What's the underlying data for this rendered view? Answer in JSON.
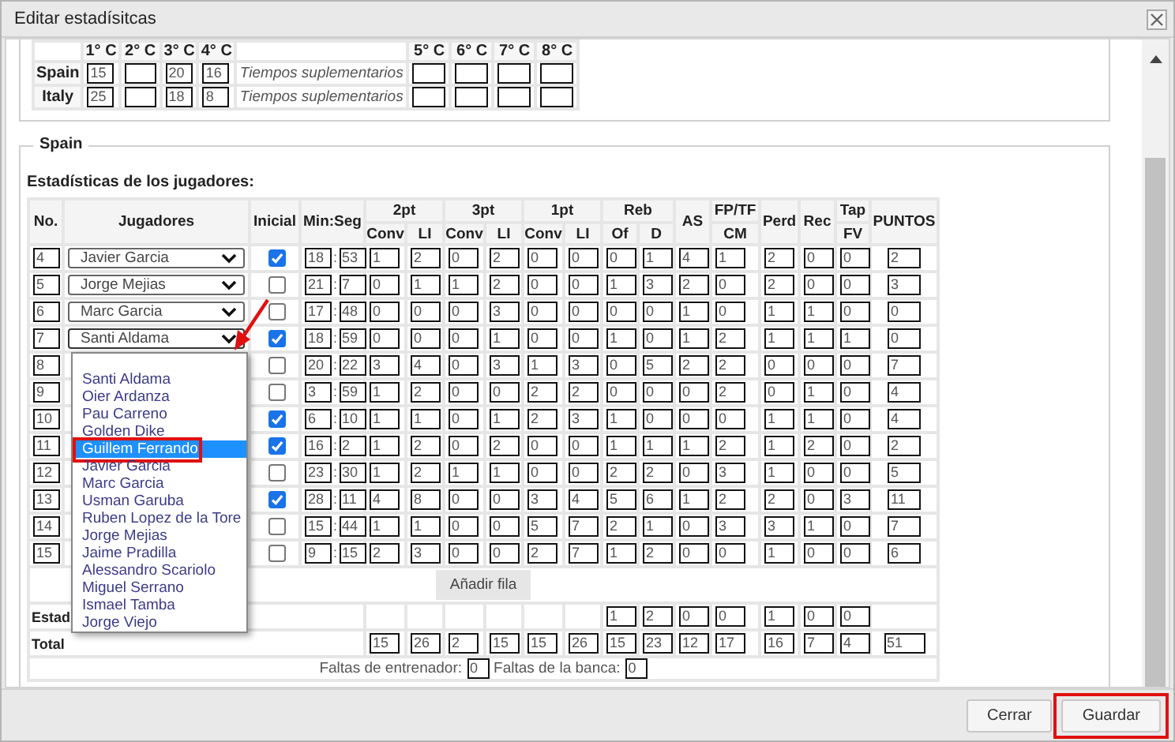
{
  "dialog": {
    "title": "Editar estadísitcas"
  },
  "quarters": {
    "columns": [
      "1° C",
      "2° C",
      "3° C",
      "4° C",
      "5° C",
      "6° C",
      "7° C",
      "8° C"
    ],
    "teams": [
      {
        "name": "Spain",
        "scores": [
          {
            "empty": false,
            "value": "15"
          },
          {
            "empty": true
          },
          {
            "empty": false,
            "value": "20"
          },
          {
            "empty": false,
            "value": "16"
          },
          {
            "empty": true
          },
          {
            "empty": true
          },
          {
            "empty": true
          },
          {
            "empty": true
          }
        ],
        "overtime_label": "Tiempos suplementarios"
      },
      {
        "name": "Italy",
        "scores": [
          {
            "empty": false,
            "value": "25"
          },
          {
            "empty": true
          },
          {
            "empty": false,
            "value": "18"
          },
          {
            "empty": false,
            "value": "8"
          },
          {
            "empty": true
          },
          {
            "empty": true
          },
          {
            "empty": true
          },
          {
            "empty": true
          }
        ],
        "overtime_label": "Tiempos suplementarios"
      }
    ]
  },
  "team_section": {
    "legend": "Spain",
    "heading": "Estadísticas de los jugadores:",
    "header_groups": [
      {
        "label": "No."
      },
      {
        "label": "Jugadores"
      },
      {
        "label": "Inicial"
      },
      {
        "label": "Min:Seg"
      },
      {
        "label": "2pt",
        "sub": [
          "Conv",
          "LI"
        ]
      },
      {
        "label": "3pt",
        "sub": [
          "Conv",
          "LI"
        ]
      },
      {
        "label": "1pt",
        "sub": [
          "Conv",
          "LI"
        ]
      },
      {
        "label": "Reb",
        "sub": [
          "Of",
          "D"
        ]
      },
      {
        "label": "AS"
      },
      {
        "label": "FP/TF",
        "sub": [
          "CM"
        ]
      },
      {
        "label": "Perd"
      },
      {
        "label": "Rec"
      },
      {
        "label": "Tap",
        "sub": [
          "FV"
        ]
      },
      {
        "label": "PUNTOS"
      }
    ],
    "time_separator": ":",
    "rows": [
      {
        "no": "4",
        "player": "Javier Garcia",
        "dropdown_open": false,
        "inicial": true,
        "min": "18",
        "sec": "53",
        "stats": [
          "1",
          "2",
          "0",
          "2",
          "0",
          "0",
          "0",
          "1",
          "4",
          "1",
          "2",
          "0",
          "0",
          "2"
        ]
      },
      {
        "no": "5",
        "player": "Jorge Mejias",
        "dropdown_open": false,
        "inicial": false,
        "min": "21",
        "sec": "7",
        "stats": [
          "0",
          "1",
          "1",
          "2",
          "0",
          "0",
          "1",
          "3",
          "2",
          "0",
          "2",
          "0",
          "0",
          "3"
        ]
      },
      {
        "no": "6",
        "player": "Marc Garcia",
        "dropdown_open": false,
        "inicial": false,
        "min": "17",
        "sec": "48",
        "stats": [
          "0",
          "0",
          "0",
          "3",
          "0",
          "0",
          "0",
          "0",
          "1",
          "0",
          "1",
          "1",
          "0",
          "0"
        ]
      },
      {
        "no": "7",
        "player": "Santi Aldama",
        "dropdown_open": true,
        "inicial": true,
        "min": "18",
        "sec": "59",
        "stats": [
          "0",
          "0",
          "0",
          "1",
          "0",
          "0",
          "1",
          "0",
          "1",
          "2",
          "1",
          "1",
          "1",
          "0"
        ]
      },
      {
        "no": "8",
        "inicial": false,
        "min": "20",
        "sec": "22",
        "stats": [
          "3",
          "4",
          "0",
          "3",
          "1",
          "3",
          "0",
          "5",
          "2",
          "2",
          "0",
          "0",
          "0",
          "7"
        ]
      },
      {
        "no": "9",
        "inicial": false,
        "min": "3",
        "sec": "59",
        "stats": [
          "1",
          "2",
          "0",
          "0",
          "2",
          "2",
          "0",
          "0",
          "0",
          "2",
          "0",
          "1",
          "0",
          "4"
        ]
      },
      {
        "no": "10",
        "inicial": true,
        "min": "6",
        "sec": "10",
        "stats": [
          "1",
          "1",
          "0",
          "1",
          "2",
          "3",
          "1",
          "0",
          "0",
          "0",
          "1",
          "1",
          "0",
          "4"
        ]
      },
      {
        "no": "11",
        "inicial": true,
        "min": "16",
        "sec": "2",
        "stats": [
          "1",
          "2",
          "0",
          "2",
          "0",
          "0",
          "1",
          "1",
          "1",
          "2",
          "1",
          "2",
          "0",
          "2"
        ]
      },
      {
        "no": "12",
        "inicial": false,
        "min": "23",
        "sec": "30",
        "stats": [
          "1",
          "2",
          "1",
          "1",
          "0",
          "0",
          "2",
          "2",
          "0",
          "3",
          "1",
          "0",
          "0",
          "5"
        ]
      },
      {
        "no": "13",
        "inicial": true,
        "min": "28",
        "sec": "11",
        "stats": [
          "4",
          "8",
          "0",
          "0",
          "3",
          "4",
          "5",
          "6",
          "1",
          "2",
          "2",
          "0",
          "3",
          "11"
        ]
      },
      {
        "no": "14",
        "inicial": false,
        "min": "15",
        "sec": "44",
        "stats": [
          "1",
          "1",
          "0",
          "0",
          "5",
          "7",
          "2",
          "1",
          "0",
          "3",
          "3",
          "1",
          "0",
          "7"
        ]
      },
      {
        "no": "15",
        "inicial": false,
        "min": "9",
        "sec": "15",
        "stats": [
          "2",
          "3",
          "0",
          "0",
          "2",
          "7",
          "1",
          "2",
          "0",
          "0",
          "1",
          "0",
          "0",
          "6"
        ]
      }
    ],
    "add_row_button": "Añadir fila",
    "team_stats_row": {
      "label": "Estad",
      "stats": [
        {
          "empty": true
        },
        {
          "empty": true
        },
        {
          "empty": true
        },
        {
          "empty": true
        },
        {
          "empty": true
        },
        {
          "empty": true
        },
        {
          "empty": false,
          "value": "1"
        },
        {
          "empty": false,
          "value": "2"
        },
        {
          "empty": false,
          "value": "0"
        },
        {
          "empty": false,
          "value": "0"
        },
        {
          "empty": false,
          "value": "1"
        },
        {
          "empty": false,
          "value": "0"
        },
        {
          "empty": false,
          "value": "0"
        },
        {
          "empty": true
        }
      ]
    },
    "total_row": {
      "label": "Total",
      "stats": [
        "15",
        "26",
        "2",
        "15",
        "15",
        "26",
        "15",
        "23",
        "12",
        "17",
        "16",
        "7",
        "4",
        "51"
      ]
    },
    "coach_fouls": {
      "label": "Faltas de entrenador:",
      "value": "0"
    },
    "bench_fouls": {
      "label": "Faltas de la banca:",
      "value": "0"
    }
  },
  "player_dropdown": {
    "leading_blank_option": true,
    "options": [
      {
        "label": "Santi Aldama",
        "selected": false,
        "annotated": false
      },
      {
        "label": "Oier Ardanza",
        "selected": false,
        "annotated": false
      },
      {
        "label": "Pau Carreno",
        "selected": false,
        "annotated": false
      },
      {
        "label": "Golden Dike",
        "selected": false,
        "annotated": false
      },
      {
        "label": "Guillem Ferrando",
        "selected": true,
        "annotated": true
      },
      {
        "label": "Javier Garcia",
        "selected": false,
        "annotated": false
      },
      {
        "label": "Marc Garcia",
        "selected": false,
        "annotated": false
      },
      {
        "label": "Usman Garuba",
        "selected": false,
        "annotated": false
      },
      {
        "label": "Ruben Lopez de la Tore",
        "selected": false,
        "annotated": false
      },
      {
        "label": "Jorge Mejias",
        "selected": false,
        "annotated": false
      },
      {
        "label": "Jaime Pradilla",
        "selected": false,
        "annotated": false
      },
      {
        "label": "Alessandro Scariolo",
        "selected": false,
        "annotated": false
      },
      {
        "label": "Miguel Serrano",
        "selected": false,
        "annotated": false
      },
      {
        "label": "Ismael Tamba",
        "selected": false,
        "annotated": false
      },
      {
        "label": "Jorge Viejo",
        "selected": false,
        "annotated": false
      }
    ]
  },
  "annotation_arrow": true,
  "footer_buttons": [
    {
      "label": "Cerrar",
      "annotated": false
    },
    {
      "label": "Guardar",
      "annotated": true
    }
  ]
}
